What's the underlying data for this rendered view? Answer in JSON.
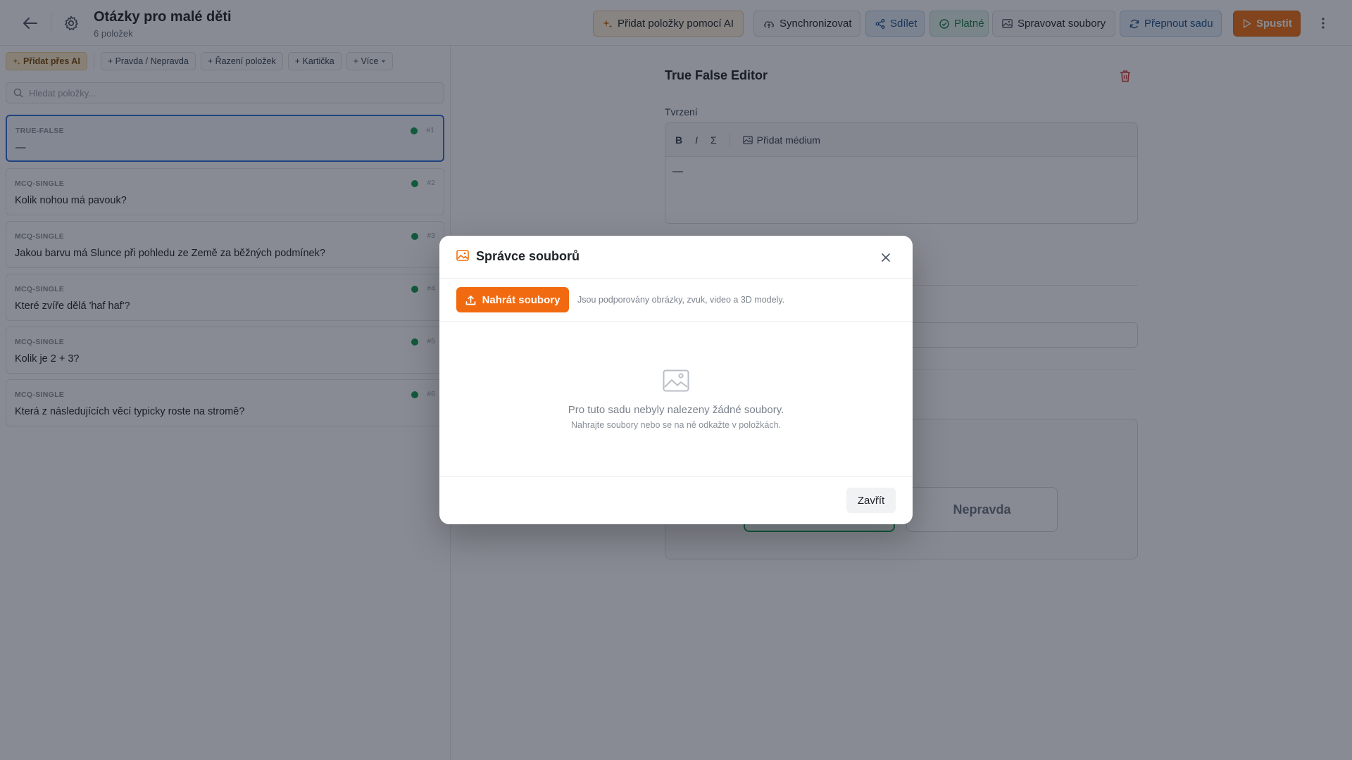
{
  "header": {
    "title": "Otázky pro malé děti",
    "item_count": "6 položek",
    "buttons": {
      "ai": "Přidat položky pomocí AI",
      "sync": "Synchronizovat",
      "share": "Sdílet",
      "valid": "Platné",
      "files": "Spravovat soubory",
      "switch": "Přepnout sadu",
      "run": "Spustit"
    }
  },
  "left": {
    "chips": {
      "ai": "Přidat přes AI",
      "true_false": "+ Pravda / Nepravda",
      "ordering": "+ Řazení položek",
      "card": "+ Kartička",
      "more": "+ Více"
    },
    "search_placeholder": "Hledat položky...",
    "items": [
      {
        "type": "TRUE-FALSE",
        "num": "#1",
        "text": "—"
      },
      {
        "type": "MCQ-SINGLE",
        "num": "#2",
        "text": "Kolik nohou má pavouk?"
      },
      {
        "type": "MCQ-SINGLE",
        "num": "#3",
        "text": "Jakou barvu má Slunce při pohledu ze Země za běžných podmínek?"
      },
      {
        "type": "MCQ-SINGLE",
        "num": "#4",
        "text": "Které zvíře dělá 'haf haf'?"
      },
      {
        "type": "MCQ-SINGLE",
        "num": "#5",
        "text": "Kolik je 2 + 3?"
      },
      {
        "type": "MCQ-SINGLE",
        "num": "#6",
        "text": "Která z následujících věcí typicky roste na stromě?"
      }
    ]
  },
  "editor": {
    "title": "True False Editor",
    "statement_label": "Tvrzení",
    "toolbar": {
      "bold": "B",
      "italic": "I",
      "sigma": "Σ",
      "media": "Přidat médium"
    },
    "content": "—",
    "false_label": "Nepravda"
  },
  "modal": {
    "title": "Správce souborů",
    "upload_label": "Nahrát soubory",
    "hint": "Jsou podporovány obrázky, zvuk, video a 3D modely.",
    "empty_main": "Pro tuto sadu nebyly nalezeny žádné soubory.",
    "empty_sub": "Nahrajte soubory nebo se na ně odkažte v položkách.",
    "close_label": "Zavřít"
  },
  "colors": {
    "accent_orange": "#f26a10",
    "active_blue": "#2f6fd6",
    "status_green": "#159a4f"
  }
}
